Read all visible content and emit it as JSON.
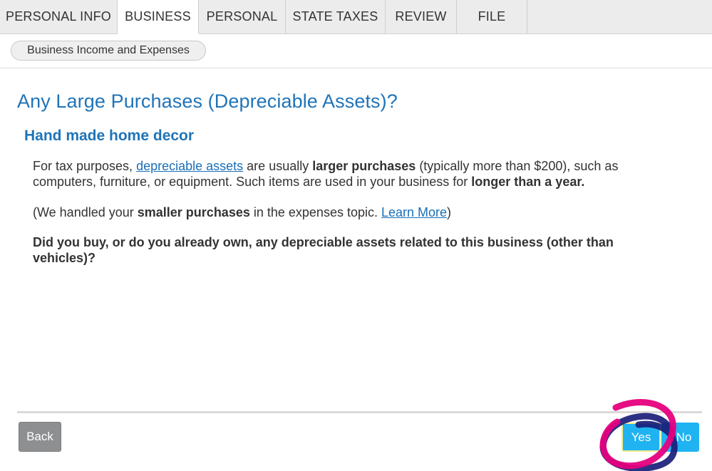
{
  "tabs": [
    {
      "label": "PERSONAL INFO",
      "active": false
    },
    {
      "label": "BUSINESS",
      "active": true
    },
    {
      "label": "PERSONAL",
      "active": false
    },
    {
      "label": "STATE TAXES",
      "active": false
    },
    {
      "label": "REVIEW",
      "active": false
    },
    {
      "label": "FILE",
      "active": false
    }
  ],
  "breadcrumb": {
    "label": "Business Income and Expenses"
  },
  "page": {
    "title": "Any Large Purchases (Depreciable Assets)?",
    "subtitle": "Hand made home decor",
    "p1": {
      "t1": "For tax purposes, ",
      "link": "depreciable assets",
      "t2": " are usually ",
      "b1": "larger purchases",
      "t3": " (typically more than $200), such as computers, furniture, or equipment. Such items are used in your business for ",
      "b2": "longer than a year."
    },
    "p2": {
      "t1": "(We handled your ",
      "b1": "smaller purchases",
      "t2": " in the expenses topic. ",
      "link": "Learn More",
      "t3": ")"
    },
    "question": "Did you buy, or do you already own, any depreciable assets related to this business (other than vehicles)?"
  },
  "footer": {
    "back_label": "Back",
    "yes_label": "Yes",
    "no_label": "No"
  },
  "colors": {
    "accent": "#1f74b8",
    "button_primary": "#1fb3f2",
    "button_secondary": "#8d8f91",
    "annotation_magenta": "#e6007e",
    "annotation_navy": "#1a1e7a"
  }
}
